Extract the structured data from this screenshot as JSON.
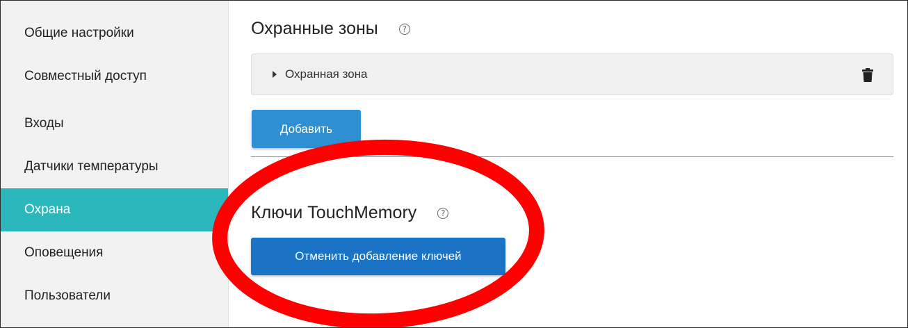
{
  "sidebar": {
    "items": [
      {
        "label": "Общие настройки",
        "active": false
      },
      {
        "label": "Совместный доступ",
        "active": false
      },
      {
        "label": "Входы",
        "active": false
      },
      {
        "label": "Датчики температуры",
        "active": false
      },
      {
        "label": "Охрана",
        "active": true
      },
      {
        "label": "Оповещения",
        "active": false
      },
      {
        "label": "Пользователи",
        "active": false
      }
    ],
    "active_color": "#2bb8bd"
  },
  "zones": {
    "title": "Охранные зоны",
    "help_glyph": "?",
    "items": [
      {
        "label": "Охранная зона"
      }
    ],
    "add_label": "Добавить"
  },
  "keys": {
    "title": "Ключи TouchMemory",
    "help_glyph": "?",
    "cancel_label": "Отменить добавление ключей"
  },
  "annotation": {
    "color": "#ff0000",
    "shape": "ellipse"
  }
}
